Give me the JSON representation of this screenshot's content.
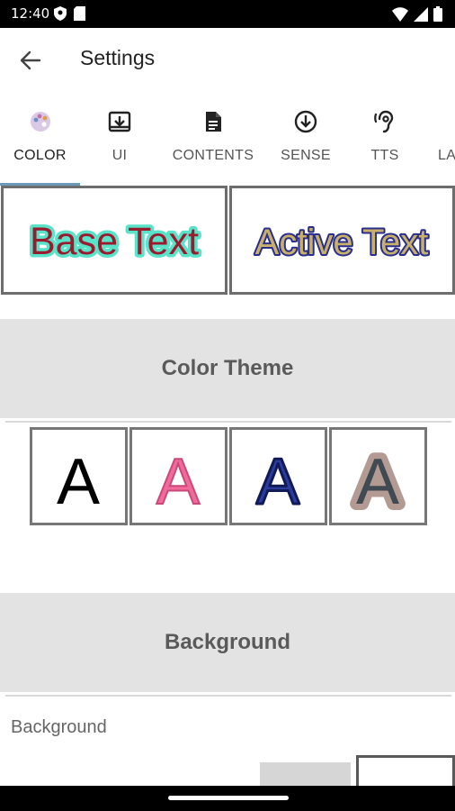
{
  "status_bar": {
    "time": "12:40",
    "left_icons": [
      "shield-icon",
      "sd-card-icon"
    ],
    "right_icons": [
      "wifi-icon",
      "signal-icon",
      "battery-icon"
    ]
  },
  "app_bar": {
    "title": "Settings",
    "back_icon": "arrow-back-icon"
  },
  "tabs": [
    {
      "label": "COLOR",
      "icon": "palette-icon",
      "active": true
    },
    {
      "label": "UI",
      "icon": "download-box-icon",
      "active": false
    },
    {
      "label": "CONTENTS",
      "icon": "document-icon",
      "active": false
    },
    {
      "label": "SENSE",
      "icon": "arrow-circle-down-icon",
      "active": false
    },
    {
      "label": "TTS",
      "icon": "hearing-icon",
      "active": false
    },
    {
      "label": "LA",
      "icon": "",
      "active": false
    }
  ],
  "previews": {
    "base": {
      "text": "Base Text",
      "fill": "#9b1b2e",
      "outline": "#59e3c8"
    },
    "active": {
      "text": "Active Text",
      "fill": "#c8b06a",
      "outline": "#2a2f8c"
    }
  },
  "sections": {
    "color_theme": "Color Theme",
    "background": "Background"
  },
  "color_themes": [
    {
      "letter": "A",
      "fill": "#000000",
      "outline": "#000000"
    },
    {
      "letter": "A",
      "fill": "#f06a9a",
      "outline": "#c94a7a"
    },
    {
      "letter": "A",
      "fill": "#2a3c9e",
      "outline": "#111a55"
    },
    {
      "letter": "A",
      "fill": "#3f4a52",
      "outline": "#b39a92"
    }
  ],
  "background": {
    "label": "Background"
  }
}
